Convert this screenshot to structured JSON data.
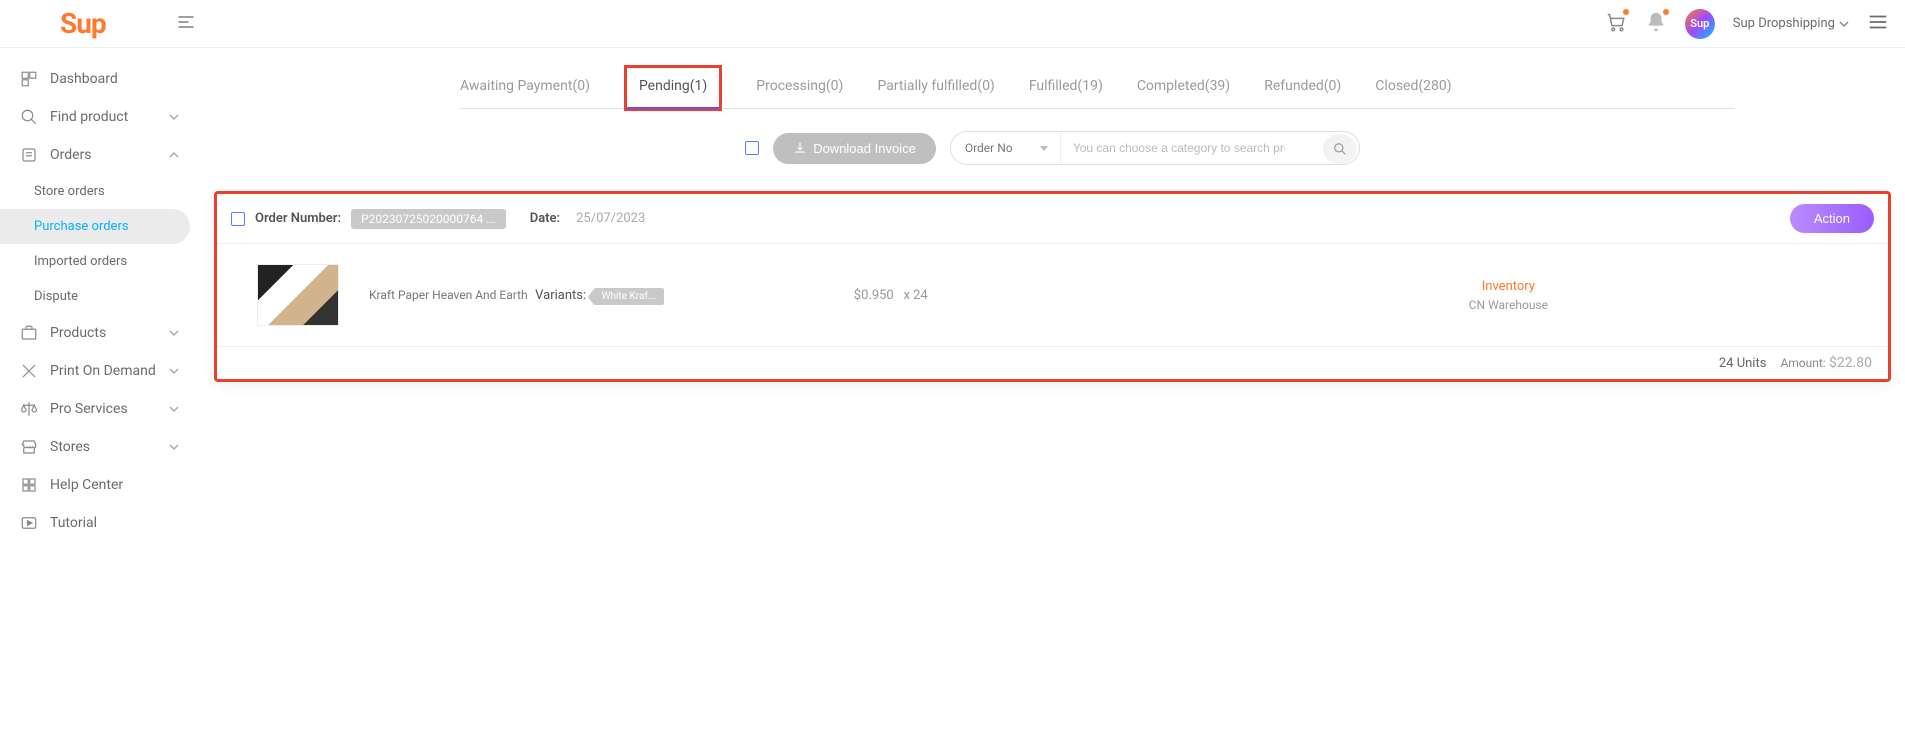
{
  "header": {
    "logo": "Sup",
    "user_name": "Sup Dropshipping"
  },
  "sidebar": {
    "dashboard": "Dashboard",
    "find_product": "Find product",
    "orders": "Orders",
    "store_orders": "Store orders",
    "purchase_orders": "Purchase orders",
    "imported_orders": "Imported orders",
    "dispute": "Dispute",
    "products": "Products",
    "print_on_demand": "Print On Demand",
    "pro_services": "Pro Services",
    "stores": "Stores",
    "help_center": "Help Center",
    "tutorial": "Tutorial"
  },
  "tabs": {
    "awaiting": "Awaiting Payment(0)",
    "pending": "Pending(1)",
    "processing": "Processing(0)",
    "partially": "Partially fulfilled(0)",
    "fulfilled": "Fulfilled(19)",
    "completed": "Completed(39)",
    "refunded": "Refunded(0)",
    "closed": "Closed(280)"
  },
  "controls": {
    "download": "Download Invoice",
    "select_label": "Order No",
    "search_placeholder": "You can choose a category to search precisely"
  },
  "order": {
    "number_label": "Order Number:",
    "number_value": "P20230725020000764 ...",
    "date_label": "Date:",
    "date_value": "25/07/2023",
    "action": "Action",
    "product_name": "Kraft Paper Heaven And Earth",
    "variants_label": "Variants:",
    "variant_value": "White Kraf...",
    "price": "$0.950",
    "qty": "x 24",
    "inventory": "Inventory",
    "warehouse": "CN Warehouse",
    "units": "24 Units",
    "amount_label": "Amount:",
    "amount_value": "$22.80"
  }
}
